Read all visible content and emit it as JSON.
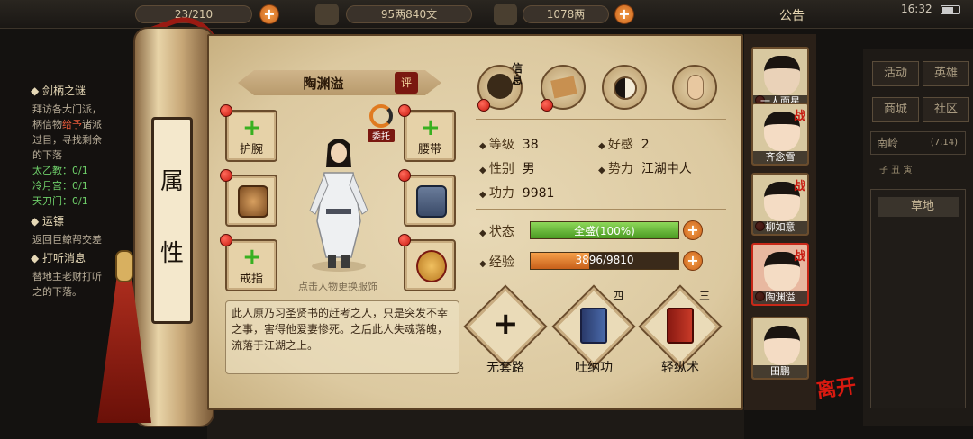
{
  "topbar": {
    "capacity": "23/210",
    "money": "95两840文",
    "ingots": "1078两",
    "notice": "公告",
    "time": "16:32"
  },
  "quests": {
    "q1_title": "剑柄之谜",
    "q1_line1": "拜访各大门派，",
    "q1_line2_pre": "柄信物",
    "q1_line2_red": "给予",
    "q1_line2_post": "诸派",
    "q1_line3": "过目，寻找剩余",
    "q1_line4": "的下落",
    "q1_p1": "太乙教：0/1",
    "q1_p2": "冷月宫：0/1",
    "q1_p3": "天刀门：0/1",
    "q2_title": "运镖",
    "q2_line1": "返回巨鲸帮交差",
    "q3_title": "打听消息",
    "q3_line1": "替地主老财打听",
    "q3_line2": "之的下落。"
  },
  "scroll": {
    "char1": "属",
    "char2": "性"
  },
  "character": {
    "name": "陶渊溢",
    "review_badge": "评",
    "delegate_label": "委托",
    "tip": "点击人物更换服饰",
    "description": "此人原乃习圣贤书的赶考之人，只是突发不幸之事，害得他爱妻惨死。之后此人失魂落魄，流落于江湖之上。"
  },
  "equipment": {
    "wrist": "护腕",
    "belt": "腰带",
    "ring": "戒指"
  },
  "tabs": {
    "info_text": "信息"
  },
  "stats": {
    "level_label": "等级",
    "level": "38",
    "favor_label": "好感",
    "favor": "2",
    "gender_label": "性别",
    "gender": "男",
    "faction_label": "势力",
    "faction": "江湖中人",
    "power_label": "功力",
    "power": "9981",
    "state_label": "状态",
    "state_text": "全盛(100%)",
    "state_ratio": 1.0,
    "exp_label": "经验",
    "exp_text": "3896/9810",
    "exp_ratio": 0.397
  },
  "skills": {
    "s1": "无套路",
    "s2": "吐纳功",
    "s2_rank": "四",
    "s3": "轻纵术",
    "s3_rank": "三"
  },
  "party": [
    {
      "name": "一人面星",
      "war": ""
    },
    {
      "name": "齐念雪",
      "war": "战"
    },
    {
      "name": "柳如意",
      "war": "战"
    },
    {
      "name": "陶渊溢",
      "war": "战"
    },
    {
      "name": "田鹏",
      "war": ""
    }
  ],
  "leave_label": "离开",
  "right_menu": {
    "activity": "活动",
    "hero": "英雄",
    "shop": "商城",
    "community": "社区",
    "region": "南岭",
    "coord": "(7,14)",
    "hours": "子  丑  寅",
    "terrain": "草地"
  },
  "colors": {
    "hp_bar": "#6fbe3a",
    "exp_bar": "#e07a20",
    "dot": "#d8281a"
  }
}
